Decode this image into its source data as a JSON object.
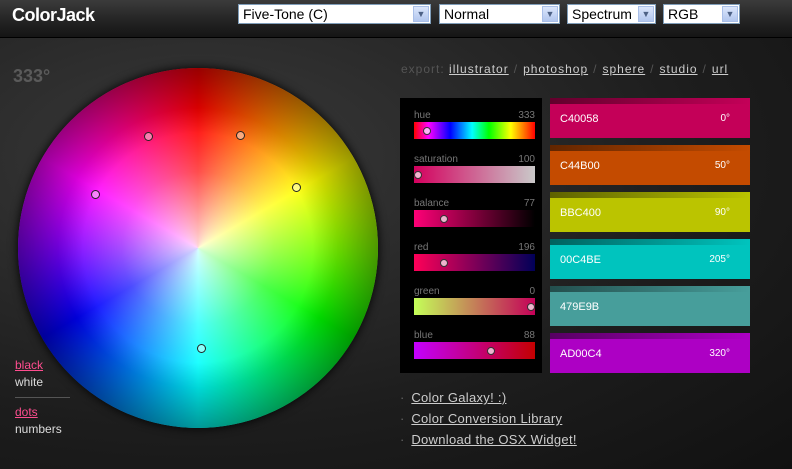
{
  "app": {
    "title": "ColorJack"
  },
  "selects": [
    {
      "value": "Five-Tone (C)"
    },
    {
      "value": "Normal"
    },
    {
      "value": "Spectrum"
    },
    {
      "value": "RGB"
    }
  ],
  "wheel": {
    "degree": "333°"
  },
  "export": {
    "label": "export:",
    "links": [
      "illustrator",
      "photoshop",
      "sphere",
      "studio",
      "url"
    ],
    "separator": "/"
  },
  "sliders": [
    {
      "label": "hue",
      "value": "333",
      "fraction": 0.08
    },
    {
      "label": "saturation",
      "value": "100",
      "fraction": 0.0
    },
    {
      "label": "balance",
      "value": "77",
      "fraction": 0.23
    },
    {
      "label": "red",
      "value": "196",
      "fraction": 0.23
    },
    {
      "label": "green",
      "value": "0",
      "fraction": 1.0
    },
    {
      "label": "blue",
      "value": "88",
      "fraction": 0.65
    }
  ],
  "swatches": [
    {
      "hex": "C40058",
      "degree": "0°",
      "color": "#C40058"
    },
    {
      "hex": "C44B00",
      "degree": "50°",
      "color": "#C44B00"
    },
    {
      "hex": "BBC400",
      "degree": "90°",
      "color": "#BBC400"
    },
    {
      "hex": "00C4BE",
      "degree": "205°",
      "color": "#00C4BE"
    },
    {
      "hex": "479E9B",
      "degree": "",
      "color": "#479E9B"
    },
    {
      "hex": "AD00C4",
      "degree": "320°",
      "color": "#AD00C4"
    }
  ],
  "links": [
    {
      "label": "Color Galaxy! :)"
    },
    {
      "label": "Color Conversion Library"
    },
    {
      "label": "Download the OSX Widget!"
    }
  ],
  "toggles": {
    "black": "black",
    "white": "white",
    "dots": "dots",
    "numbers": "numbers"
  }
}
